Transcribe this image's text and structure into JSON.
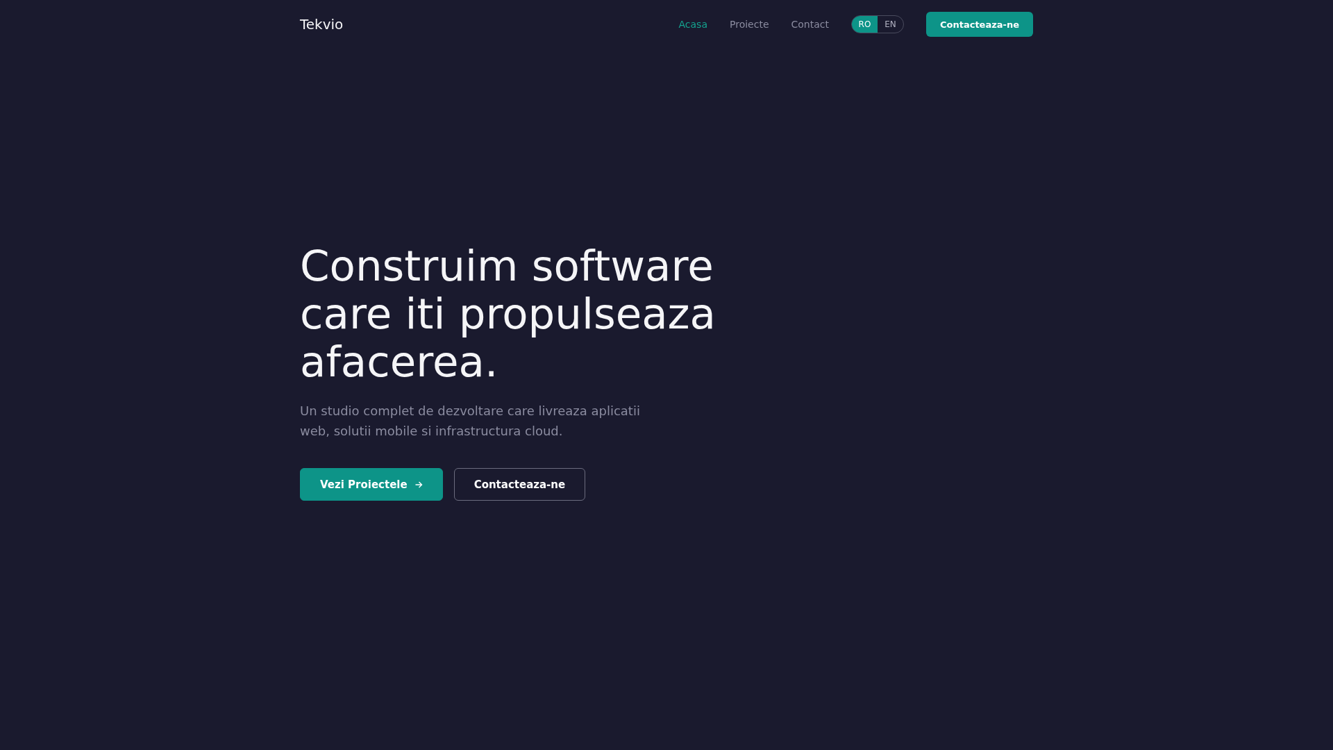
{
  "nav": {
    "logo": "Tekvio",
    "links": [
      {
        "label": "Acasa",
        "selected": true
      },
      {
        "label": "Proiecte",
        "selected": false
      },
      {
        "label": "Contact",
        "selected": false
      }
    ],
    "languages": [
      {
        "label": "RO",
        "selected": true
      },
      {
        "label": "EN",
        "selected": false
      }
    ],
    "cta": "Contacteaza-ne"
  },
  "hero": {
    "headline": "Construim software care iti propulseaza afacerea.",
    "subtitle": "Un studio complet de dezvoltare care livreaza aplicatii web, solutii mobile si infrastructura cloud.",
    "buttons": [
      {
        "kind": "primary",
        "label": "Vezi Proiectele"
      },
      {
        "kind": "secondary",
        "label": "Contacteaza-ne"
      }
    ]
  }
}
